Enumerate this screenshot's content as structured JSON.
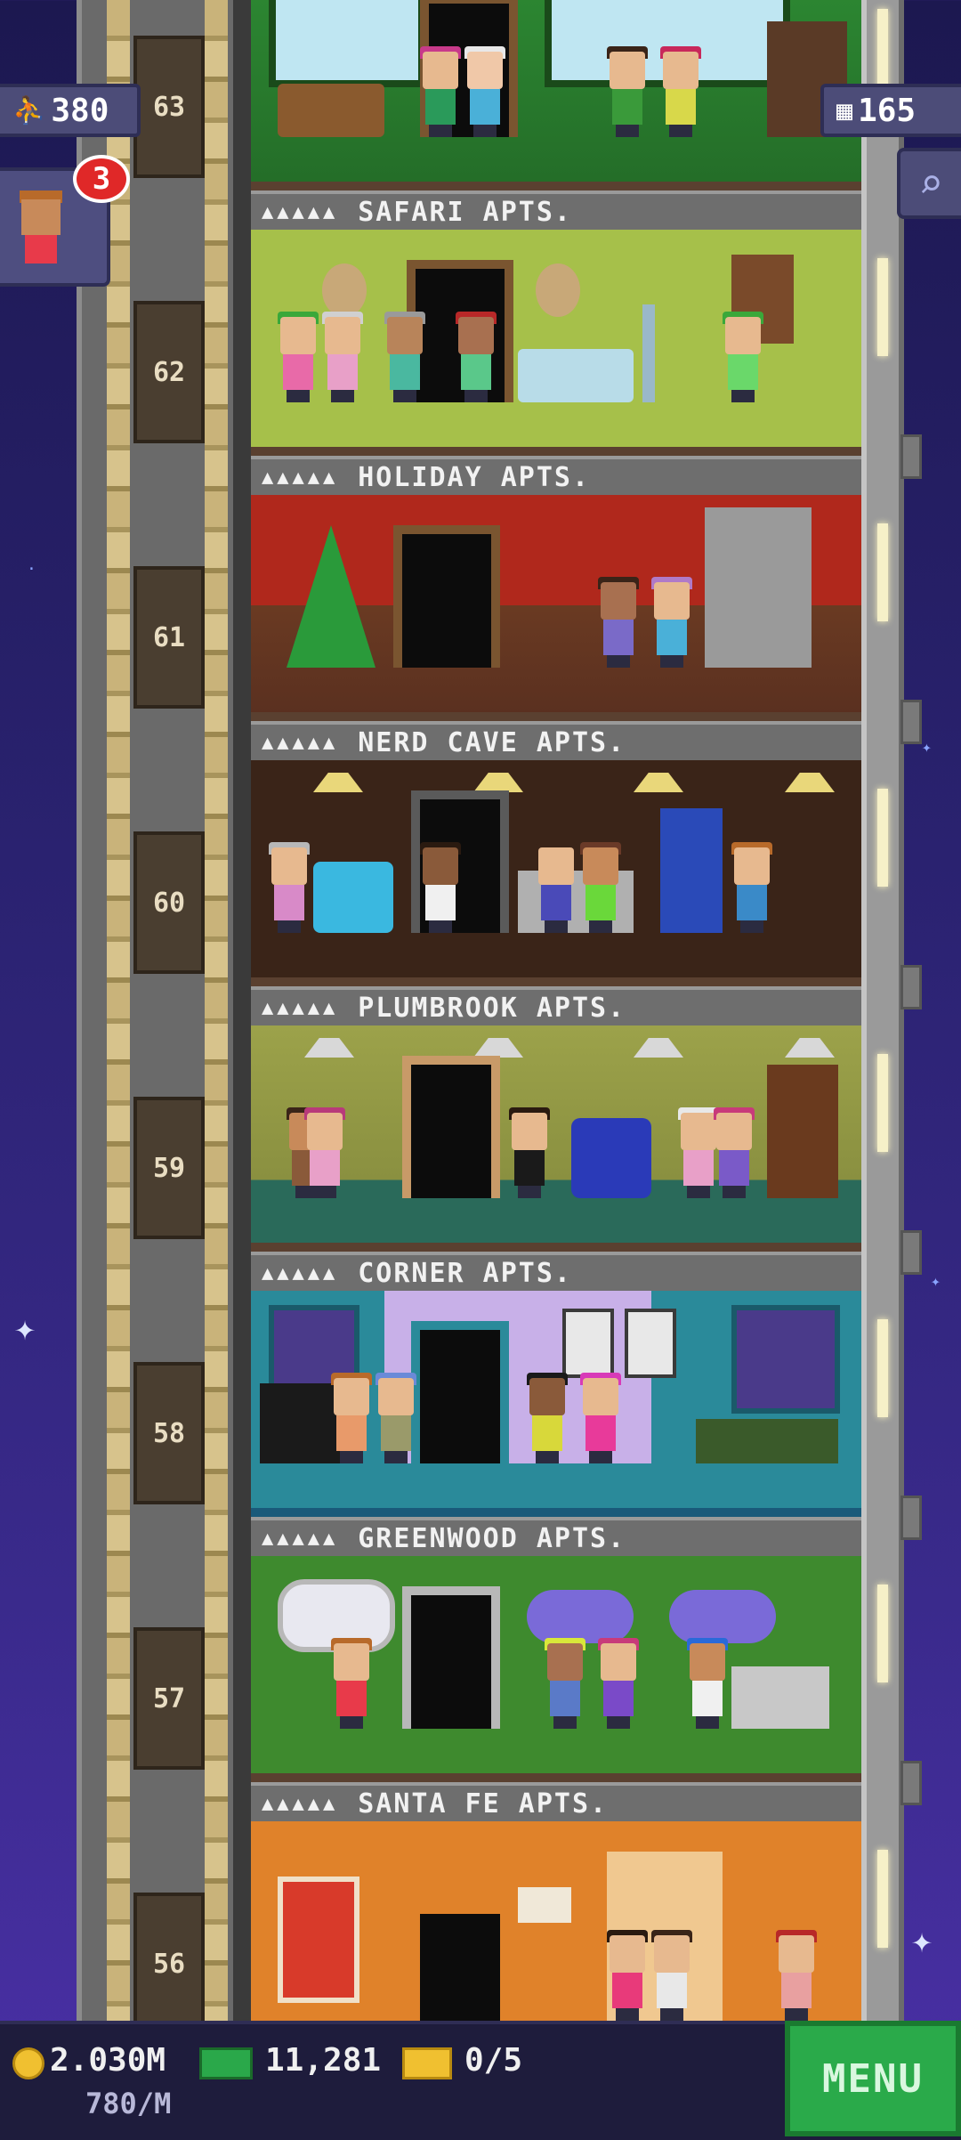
{
  "hud": {
    "population": "380",
    "population_icon": "person-icon",
    "current_floor_label": "63",
    "bux": "165",
    "bux_icon": "building-icon",
    "notification_count": "3",
    "search_icon": "magnifier-icon"
  },
  "floor_numbers": [
    "63",
    "62",
    "61",
    "60",
    "59",
    "58",
    "57",
    "56"
  ],
  "floors": [
    {
      "name": "SAFARI APTS.",
      "stars": "▲▲▲▲▲",
      "theme": "#2a7a2e"
    },
    {
      "name": "HOLIDAY APTS.",
      "stars": "▲▲▲▲▲",
      "theme": "#a6c04a"
    },
    {
      "name": "NERD CAVE APTS.",
      "stars": "▲▲▲▲▲",
      "theme": "#b0281c"
    },
    {
      "name": "PLUMBROOK APTS.",
      "stars": "▲▲▲▲▲",
      "theme": "#3a2418"
    },
    {
      "name": "CORNER APTS.",
      "stars": "▲▲▲▲▲",
      "theme": "#9ca24a"
    },
    {
      "name": "GREENWOOD APTS.",
      "stars": "▲▲▲▲▲",
      "theme": "#8a7ac8"
    },
    {
      "name": "SANTA FE APTS.",
      "stars": "▲▲▲▲▲",
      "theme": "#3e8a2e"
    },
    {
      "name": "",
      "stars": "",
      "theme": "#e0822a"
    }
  ],
  "bottom": {
    "coins": "2.030M",
    "coins_icon": "coin-icon",
    "bux": "11,281",
    "bux_icon": "cash-icon",
    "tickets": "0/5",
    "tickets_icon": "ticket-icon",
    "rate": "780/M",
    "menu_label": "MENU"
  }
}
